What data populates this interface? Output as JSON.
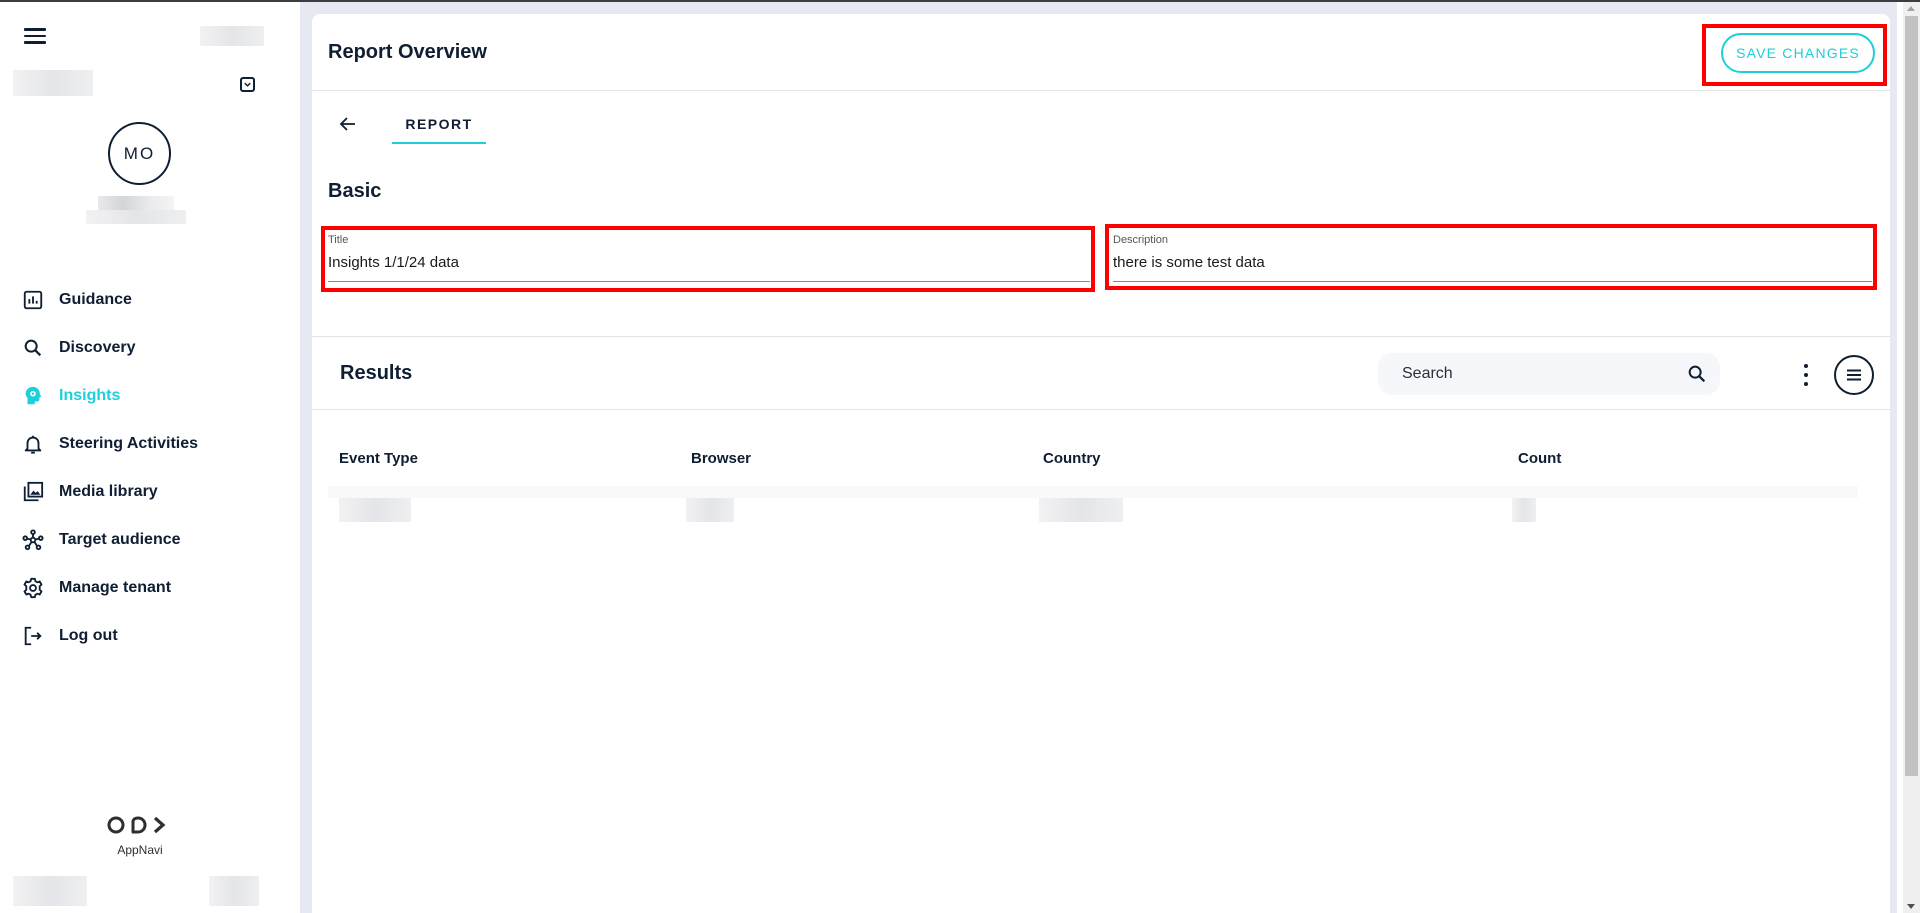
{
  "app": {
    "brand_name": "AppNavi",
    "accent_color": "#1ecfdb",
    "text_color": "#0f1e33"
  },
  "sidebar": {
    "menu_icon": "hamburger-menu-icon",
    "user_initials": "MO",
    "tenant_dropdown_icon": "chevron-down-icon",
    "items": [
      {
        "label": "Guidance",
        "icon": "bar-chart-icon",
        "active": false
      },
      {
        "label": "Discovery",
        "icon": "search-icon",
        "active": false
      },
      {
        "label": "Insights",
        "icon": "head-lightbulb-icon",
        "active": true
      },
      {
        "label": "Steering Activities",
        "icon": "bell-icon",
        "active": false
      },
      {
        "label": "Media library",
        "icon": "image-library-icon",
        "active": false
      },
      {
        "label": "Target audience",
        "icon": "network-icon",
        "active": false
      },
      {
        "label": "Manage tenant",
        "icon": "gear-icon",
        "active": false
      },
      {
        "label": "Log out",
        "icon": "logout-icon",
        "active": false
      }
    ]
  },
  "header": {
    "title": "Report Overview",
    "save_label": "SAVE CHANGES"
  },
  "tabs": [
    {
      "label": "REPORT",
      "active": true
    }
  ],
  "basic": {
    "heading": "Basic",
    "title_field": {
      "label": "Title",
      "value": "Insights 1/1/24 data"
    },
    "description_field": {
      "label": "Description",
      "value": "there is some test data"
    }
  },
  "results": {
    "heading": "Results",
    "search_placeholder": "Search",
    "columns": [
      "Event Type",
      "Browser",
      "Country",
      "Count"
    ]
  }
}
